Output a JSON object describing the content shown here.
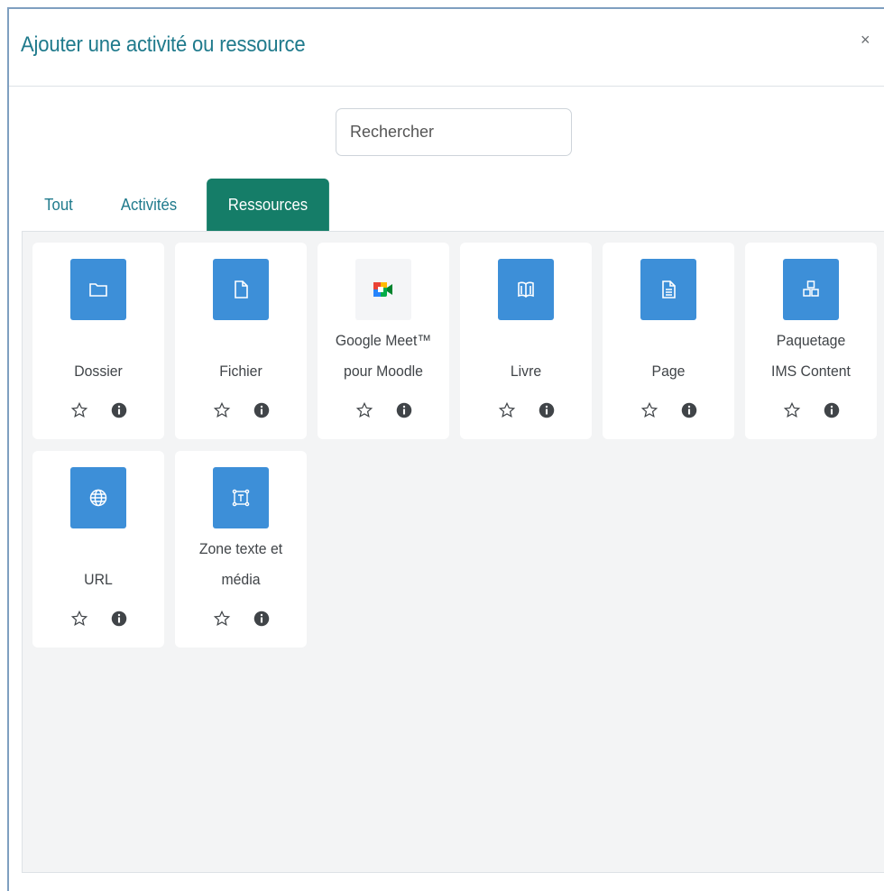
{
  "modal": {
    "title": "Ajouter une activité ou ressource",
    "close_label": "×"
  },
  "search": {
    "placeholder": "Rechercher"
  },
  "tabs": [
    {
      "label": "Tout",
      "active": false
    },
    {
      "label": "Activités",
      "active": false
    },
    {
      "label": "Ressources",
      "active": true
    }
  ],
  "colors": {
    "accent": "#157d68",
    "title": "#1f7a8c",
    "icon_bg": "#3d8fd8"
  },
  "modules": [
    {
      "line1": "Dossier",
      "line2": "",
      "icon": "folder-icon"
    },
    {
      "line1": "Fichier",
      "line2": "",
      "icon": "file-icon"
    },
    {
      "line1": "Google Meet™",
      "line2": "pour Moodle",
      "icon": "google-meet-icon"
    },
    {
      "line1": "Livre",
      "line2": "",
      "icon": "book-icon"
    },
    {
      "line1": "Page",
      "line2": "",
      "icon": "page-icon"
    },
    {
      "line1": "Paquetage",
      "line2": "IMS Content",
      "icon": "ims-package-icon"
    },
    {
      "line1": "URL",
      "line2": "",
      "icon": "globe-icon"
    },
    {
      "line1": "Zone texte et",
      "line2": "média",
      "icon": "text-media-icon"
    }
  ]
}
